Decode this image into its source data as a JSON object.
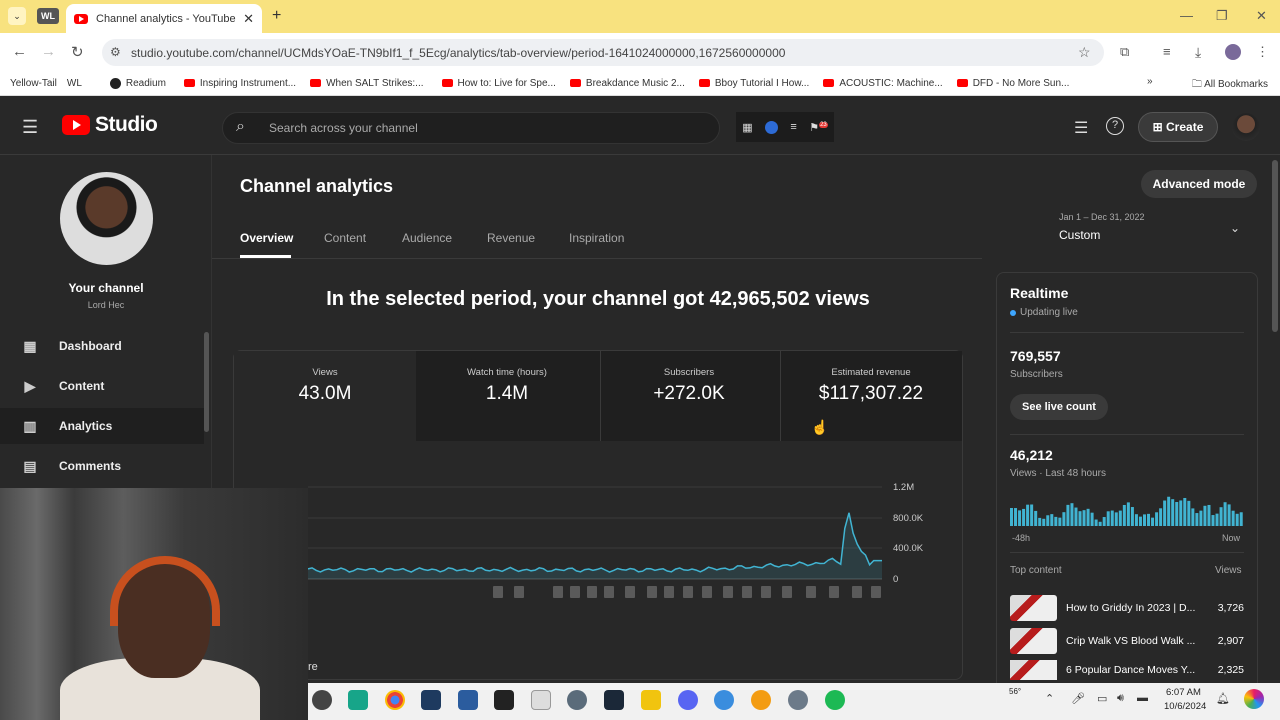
{
  "browser": {
    "tab_title": "Channel analytics - YouTube Studio",
    "tab_group": "WL",
    "url": "studio.youtube.com/channel/UCMdsYOaE-TN9bIf1_f_5Ecg/analytics/tab-overview/period-1641024000000,1672560000000",
    "bookmarks": [
      "Yellow-Tail",
      "WL",
      "Readium",
      "Inspiring Instrument...",
      "When SALT Strikes:...",
      "How to: Live for Spe...",
      "Breakdance Music 2...",
      "Bboy Tutorial I How...",
      "ACOUSTIC: Machine...",
      "DFD - No More Sun..."
    ],
    "all_bookmarks": "All Bookmarks"
  },
  "header": {
    "logo_text": "Studio",
    "search_placeholder": "Search across your channel",
    "create_label": "Create",
    "notification_count": "23"
  },
  "sidebar": {
    "your_channel": "Your channel",
    "channel_name": "Lord Hec",
    "items": [
      {
        "label": "Dashboard",
        "icon": "dashboard-icon"
      },
      {
        "label": "Content",
        "icon": "content-icon"
      },
      {
        "label": "Analytics",
        "icon": "analytics-icon",
        "active": true
      },
      {
        "label": "Comments",
        "icon": "comments-icon"
      }
    ]
  },
  "main": {
    "title": "Channel analytics",
    "advanced_mode": "Advanced mode",
    "tabs": [
      "Overview",
      "Content",
      "Audience",
      "Revenue",
      "Inspiration"
    ],
    "date_range": "Jan 1 – Dec 31, 2022",
    "date_preset": "Custom",
    "headline": "In the selected period, your channel got 42,965,502 views",
    "metrics": [
      {
        "label": "Views",
        "value": "43.0M"
      },
      {
        "label": "Watch time (hours)",
        "value": "1.4M"
      },
      {
        "label": "Subscribers",
        "value": "+272.0K"
      },
      {
        "label": "Estimated revenue",
        "value": "$117,307.22"
      }
    ],
    "chart_y_labels": [
      "1.2M",
      "800.0K",
      "400.0K",
      "0"
    ],
    "more_fragment": "re"
  },
  "realtime": {
    "title": "Realtime",
    "status": "Updating live",
    "subscribers": "769,557",
    "subscribers_label": "Subscribers",
    "see_live": "See live count",
    "views": "46,212",
    "views_label": "Views · Last 48 hours",
    "start_label": "-48h",
    "end_label": "Now",
    "top_content_label": "Top content",
    "views_col": "Views",
    "top_content": [
      {
        "title": "How to Griddy In 2023 | D...",
        "views": "3,726"
      },
      {
        "title": "Crip Walk VS Blood Walk ...",
        "views": "2,907"
      },
      {
        "title": "6 Popular Dance Moves Y...",
        "views": "2,325"
      }
    ]
  },
  "taskbar": {
    "time": "6:07 AM",
    "date": "10/6/2024",
    "temp": "56°"
  },
  "colors": {
    "accent_blue": "#3ea6ff",
    "chart_line": "#41b4d2",
    "youtube_red": "#ff0000",
    "background": "#282828"
  }
}
